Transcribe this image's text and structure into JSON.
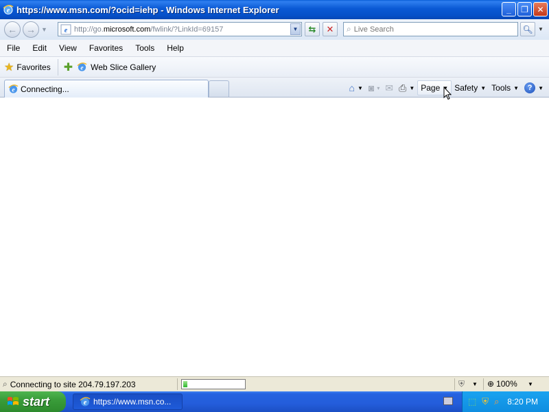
{
  "window": {
    "title": "https://www.msn.com/?ocid=iehp - Windows Internet Explorer",
    "controls": {
      "minimize": "_",
      "restore": "❐",
      "close": "✕"
    }
  },
  "address_bar": {
    "url_prefix": "http://go.",
    "url_domain": "microsoft.com",
    "url_suffix": "/fwlink/?LinkId=69157"
  },
  "search": {
    "placeholder": "Live Search"
  },
  "menu": [
    "File",
    "Edit",
    "View",
    "Favorites",
    "Tools",
    "Help"
  ],
  "favorites_bar": {
    "favorites_label": "Favorites",
    "items": [
      {
        "label": "Web Slice Gallery",
        "icon": "ie-icon"
      }
    ]
  },
  "tabs": [
    {
      "label": "Connecting...",
      "icon": "ie-loading-icon",
      "active": true
    }
  ],
  "command_bar": {
    "page_label": "Page",
    "safety_label": "Safety",
    "tools_label": "Tools",
    "help_label": "?"
  },
  "status_bar": {
    "text": "Connecting to site 204.79.197.203",
    "progress": 0.06,
    "zoom": "100%"
  },
  "taskbar": {
    "start_label": "start",
    "items": [
      {
        "label": "https://www.msn.co...",
        "icon": "ie-icon"
      }
    ],
    "clock": "8:20 PM"
  },
  "colors": {
    "title_bar": "#0a59d4",
    "taskbar": "#245ddb",
    "start_button": "#3a9d3a",
    "tray": "#0f8de0",
    "status_bar": "#ece9d8"
  }
}
